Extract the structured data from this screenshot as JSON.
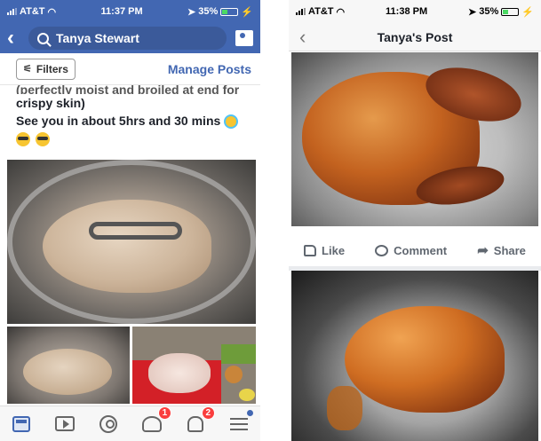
{
  "left_phone": {
    "status": {
      "carrier": "AT&T",
      "time": "11:37 PM",
      "battery": "35%"
    },
    "header": {
      "search_value": "Tanya Stewart"
    },
    "filters_label": "Filters",
    "manage_posts_label": "Manage Posts",
    "post_text": {
      "cut_line": "(perfectly moist and broiled at end for",
      "line1": "crispy skin)",
      "line2": "See you in about 5hrs and 30 mins"
    },
    "tabbar": {
      "groups_badge": "1",
      "notifications_badge": "2"
    }
  },
  "right_phone": {
    "status": {
      "carrier": "AT&T",
      "time": "11:38 PM",
      "battery": "35%"
    },
    "header_title": "Tanya's Post",
    "actions": {
      "like": "Like",
      "comment": "Comment",
      "share": "Share"
    }
  },
  "colors": {
    "facebook_blue": "#4267b2",
    "badge_red": "#fa3e3e",
    "battery_green": "#4cd964"
  }
}
